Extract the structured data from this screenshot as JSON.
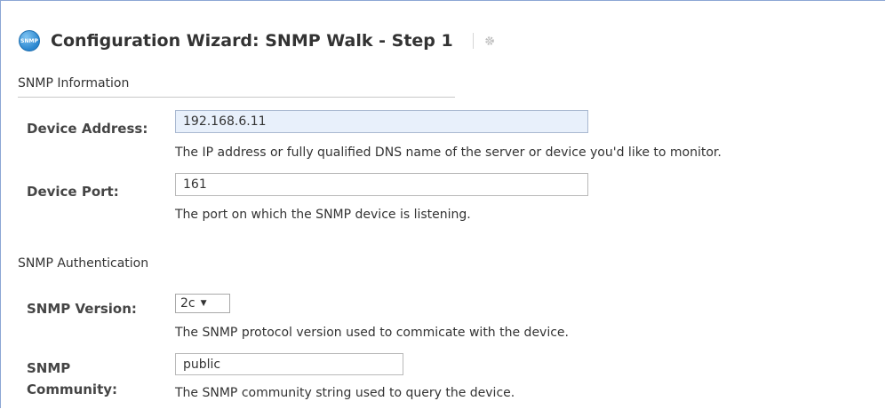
{
  "header": {
    "logo_text": "SNMP",
    "title": "Configuration Wizard: SNMP Walk - Step 1"
  },
  "snmp_information": {
    "title": "SNMP Information",
    "device_address": {
      "label": "Device Address:",
      "value": "192.168.6.11",
      "help": "The IP address or fully qualified DNS name of the server or device you'd like to monitor."
    },
    "device_port": {
      "label": "Device Port:",
      "value": "161",
      "help": "The port on which the SNMP device is listening."
    }
  },
  "snmp_authentication": {
    "title": "SNMP Authentication",
    "snmp_version": {
      "label": "SNMP Version:",
      "value": "2c",
      "help": "The SNMP protocol version used to commicate with the device."
    },
    "snmp_community": {
      "label_line1": "SNMP",
      "label_line2": "Community:",
      "value": "public",
      "help": "The SNMP community string used to query the device."
    }
  },
  "colors": {
    "frame_border": "#8ca6d4",
    "focused_input_bg": "#e8f0fb"
  }
}
